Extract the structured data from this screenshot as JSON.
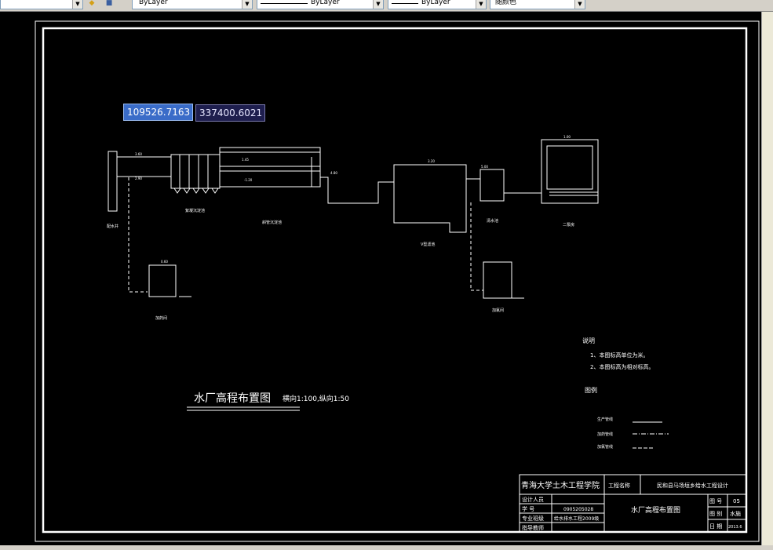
{
  "toolbar": {
    "layer_icon_1": "layer-state-icon",
    "layer_icon_2": "layer-stack-icon",
    "color_value": "ByLayer",
    "linetype_value": "ByLayer",
    "lineweight_value": "ByLayer",
    "plotstyle_value": "随颜色"
  },
  "coordinate_input": {
    "x": "109526.7163",
    "y": "337400.6021"
  },
  "drawing": {
    "title": "水厂高程布置图",
    "scale": "横向1:100,纵向1:50",
    "notes_heading": "说明",
    "notes": [
      "1、本图标高单位为米。",
      "2、本图标高为相对标高。"
    ],
    "legend_heading": "图例",
    "legend": [
      "生产管线",
      "加药管线",
      "加氯管线"
    ],
    "structures": [
      "配水井",
      "絮凝沉淀池",
      "斜管沉淀池",
      "V型滤池",
      "清水池",
      "二泵房",
      "加药间",
      "加氯间"
    ],
    "elevation_labels": [
      "3.60",
      "2.90",
      "1.45",
      "-1.20",
      "4.80",
      "3.20",
      "5.00",
      "1.00",
      "0.60"
    ]
  },
  "title_block": {
    "institution": "青海大学土木工程学院",
    "project_label": "工程名称",
    "project_name": "民和县马场垣乡给水工程设计",
    "row_labels": [
      "设计人员",
      "学 号",
      "专业班级",
      "指导教师"
    ],
    "row_values": [
      "",
      "0905205028",
      "给水排水工程2009级",
      ""
    ],
    "drawing_name": "水厂高程布置图",
    "meta_labels": [
      "图 号",
      "图 别",
      "日 期"
    ],
    "meta_values": [
      "05",
      "水施",
      "2013.6"
    ]
  }
}
